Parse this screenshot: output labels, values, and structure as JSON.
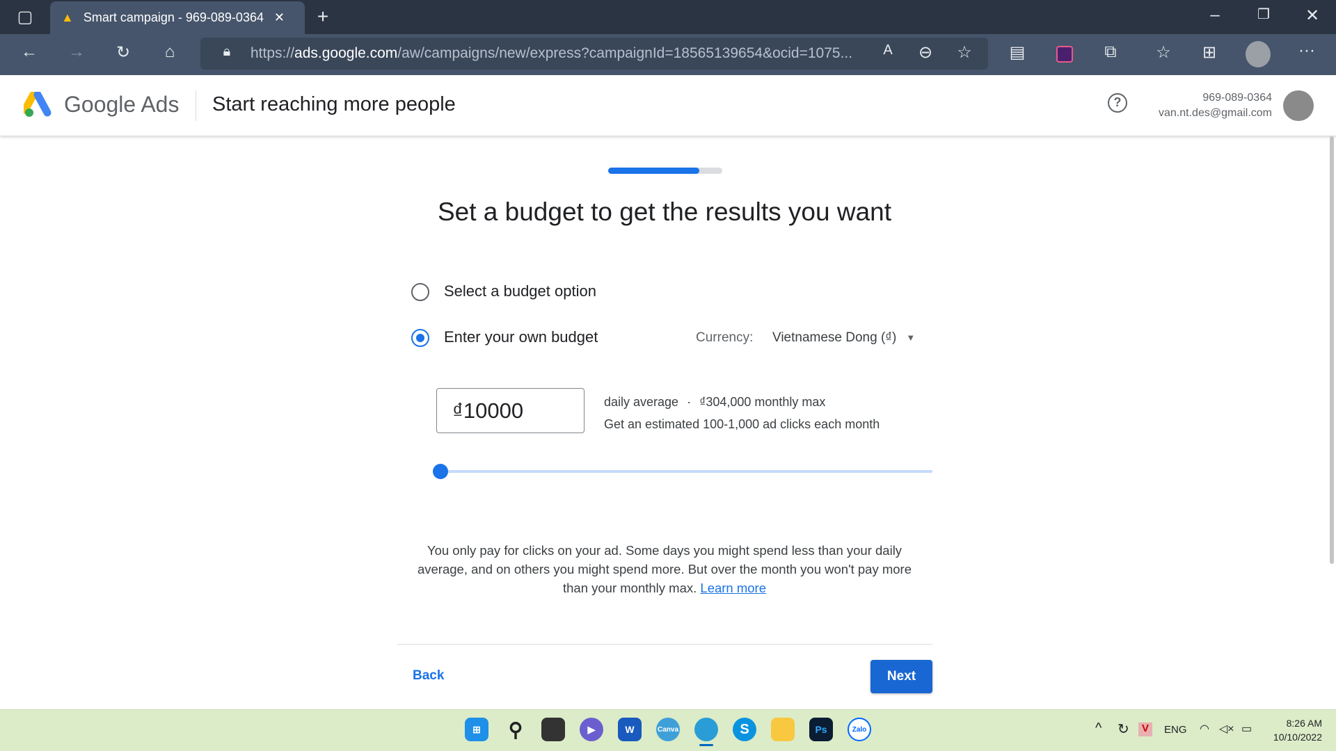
{
  "browser": {
    "tab_title": "Smart campaign - 969-089-0364",
    "url_prefix": "https://",
    "url_domain": "ads.google.com",
    "url_path": "/aw/campaigns/new/express?campaignId=18565139654&ocid=1075..."
  },
  "header": {
    "brand": "Google Ads",
    "title": "Start reaching more people",
    "account_id": "969-089-0364",
    "email": "van.nt.des@gmail.com"
  },
  "progress": {
    "fraction": 0.8
  },
  "main": {
    "heading": "Set a budget to get the results you want",
    "options": [
      {
        "label": "Select a budget option",
        "selected": false
      },
      {
        "label": "Enter your own budget",
        "selected": true
      }
    ],
    "currency_label": "Currency:",
    "currency_value": "Vietnamese Dong (₫)",
    "budget_value": "₫10000",
    "daily_average": "daily average",
    "separator": "·",
    "monthly_max": "₫304,000 monthly max",
    "estimate": "Get an estimated 100-1,000 ad clicks each month",
    "slider_fraction": 0,
    "note": "You only pay for clicks on your ad. Some days you might spend less than your daily average, and on others you might spend more. But over the month you won't pay more than your monthly max.",
    "learn_more": "Learn more",
    "back": "Back",
    "next": "Next"
  },
  "taskbar": {
    "lang": "ENG",
    "time": "8:26 AM",
    "date": "10/10/2022",
    "apps": [
      "start",
      "search",
      "task-view",
      "teams",
      "word",
      "canva",
      "edge",
      "skype",
      "file-explorer",
      "photoshop",
      "zalo"
    ]
  },
  "colors": {
    "accent": "#1a73e8",
    "next_button": "#1967d2"
  }
}
